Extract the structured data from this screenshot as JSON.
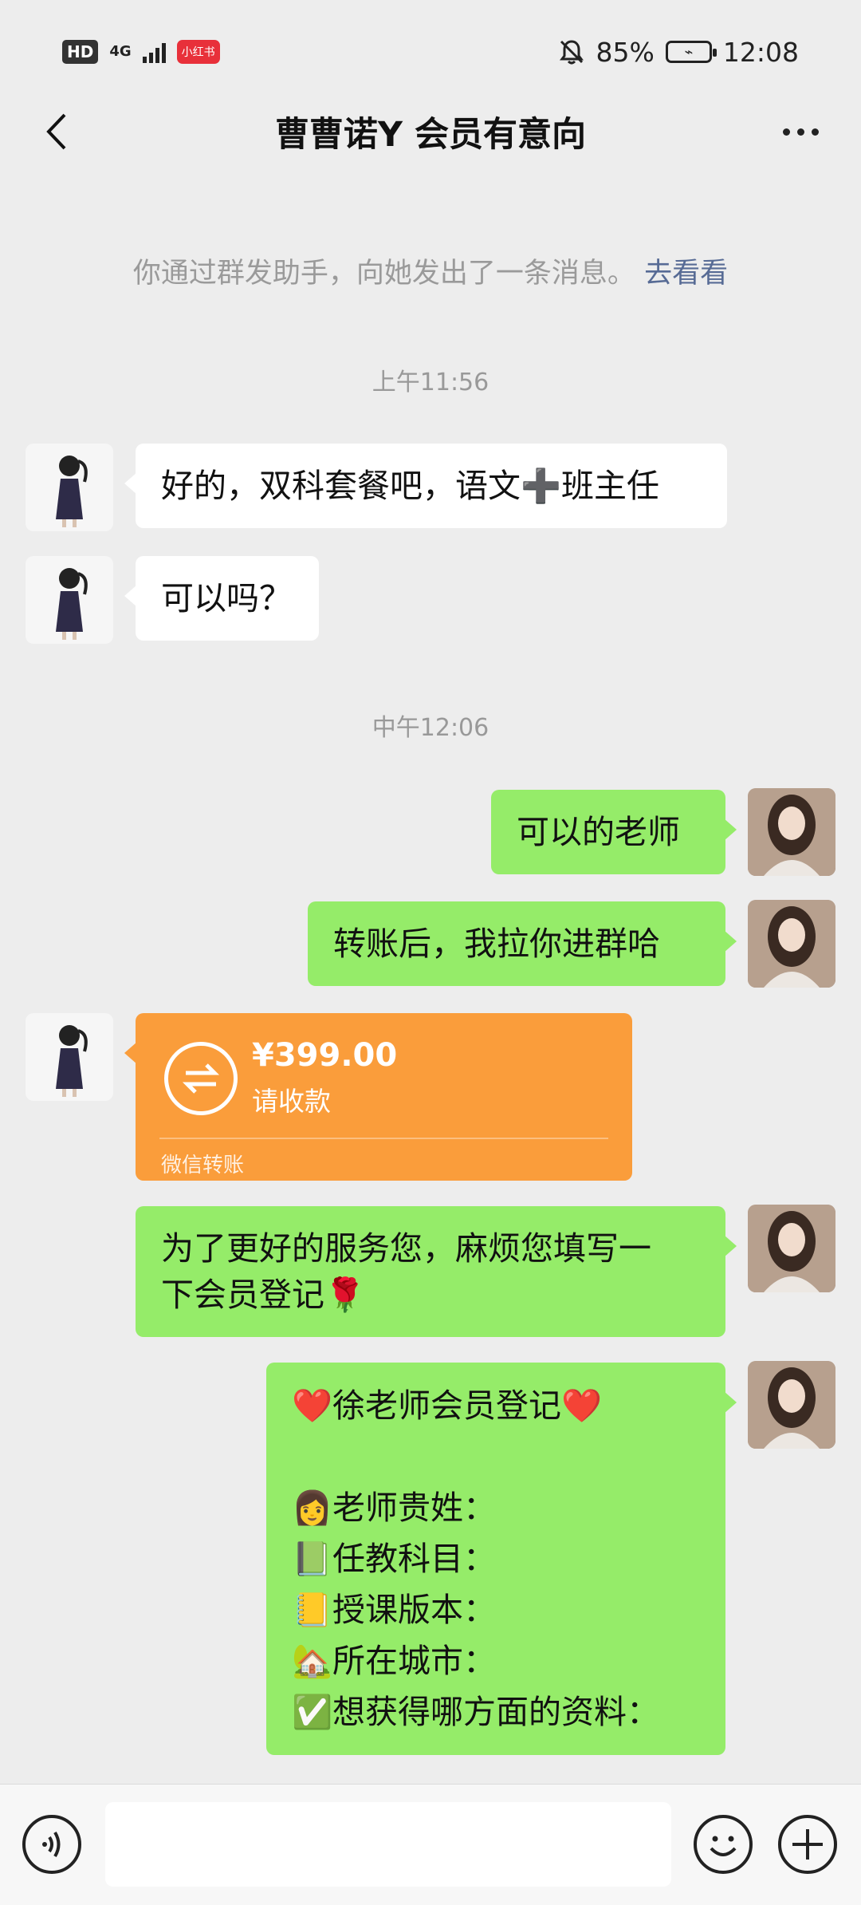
{
  "status_bar": {
    "hd": "HD",
    "network": "4G",
    "app_badge": "小红书",
    "battery_percent": "85%",
    "time": "12:08"
  },
  "header": {
    "title": "曹曹诺Y 会员有意向"
  },
  "system_note": {
    "text": "你通过群发助手，向她发出了一条消息。",
    "link": "去看看"
  },
  "timestamps": [
    "上午11:56",
    "中午12:06"
  ],
  "messages": [
    {
      "side": "left",
      "text": "好的，双科套餐吧，语文➕班主任"
    },
    {
      "side": "left",
      "text": "可以吗？"
    },
    {
      "side": "right",
      "text": "可以的老师"
    },
    {
      "side": "right",
      "text": "转账后，我拉你进群哈"
    },
    {
      "side": "right",
      "lines": [
        "为了更好的服务您，麻烦您填写一",
        "下会员登记🌹"
      ]
    }
  ],
  "transfer": {
    "amount": "¥399.00",
    "status": "请收款",
    "footer": "微信转账"
  },
  "form_message": {
    "lines": [
      "❤️徐老师会员登记❤️",
      "",
      "👩老师贵姓：",
      "📗任教科目：",
      "📒授课版本：",
      "🏡所在城市：",
      "✅想获得哪方面的资料："
    ]
  },
  "input_bar": {
    "placeholder": ""
  },
  "colors": {
    "background": "#ededed",
    "self_bubble": "#95ec69",
    "other_bubble": "#ffffff",
    "transfer": "#fa9d3b",
    "link": "#576b95"
  }
}
